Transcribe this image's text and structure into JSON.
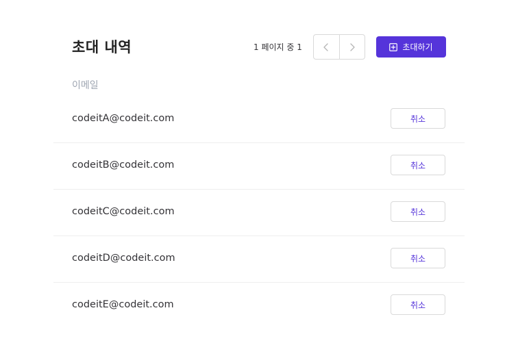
{
  "header": {
    "title": "초대 내역",
    "page_info": "1 페이지 중 1",
    "invite_label": "초대하기"
  },
  "table": {
    "column_header": "이메일",
    "cancel_label": "취소",
    "rows": [
      {
        "email": "codeitA@codeit.com"
      },
      {
        "email": "codeitB@codeit.com"
      },
      {
        "email": "codeitC@codeit.com"
      },
      {
        "email": "codeitD@codeit.com"
      },
      {
        "email": "codeitE@codeit.com"
      }
    ]
  },
  "colors": {
    "accent": "#5534DA",
    "border": "#D9D9D9",
    "muted_text": "#9FA6B2",
    "text": "#333236"
  },
  "icons": {
    "prev": "chevron-left-icon",
    "next": "chevron-right-icon",
    "invite": "plus-square-icon"
  }
}
